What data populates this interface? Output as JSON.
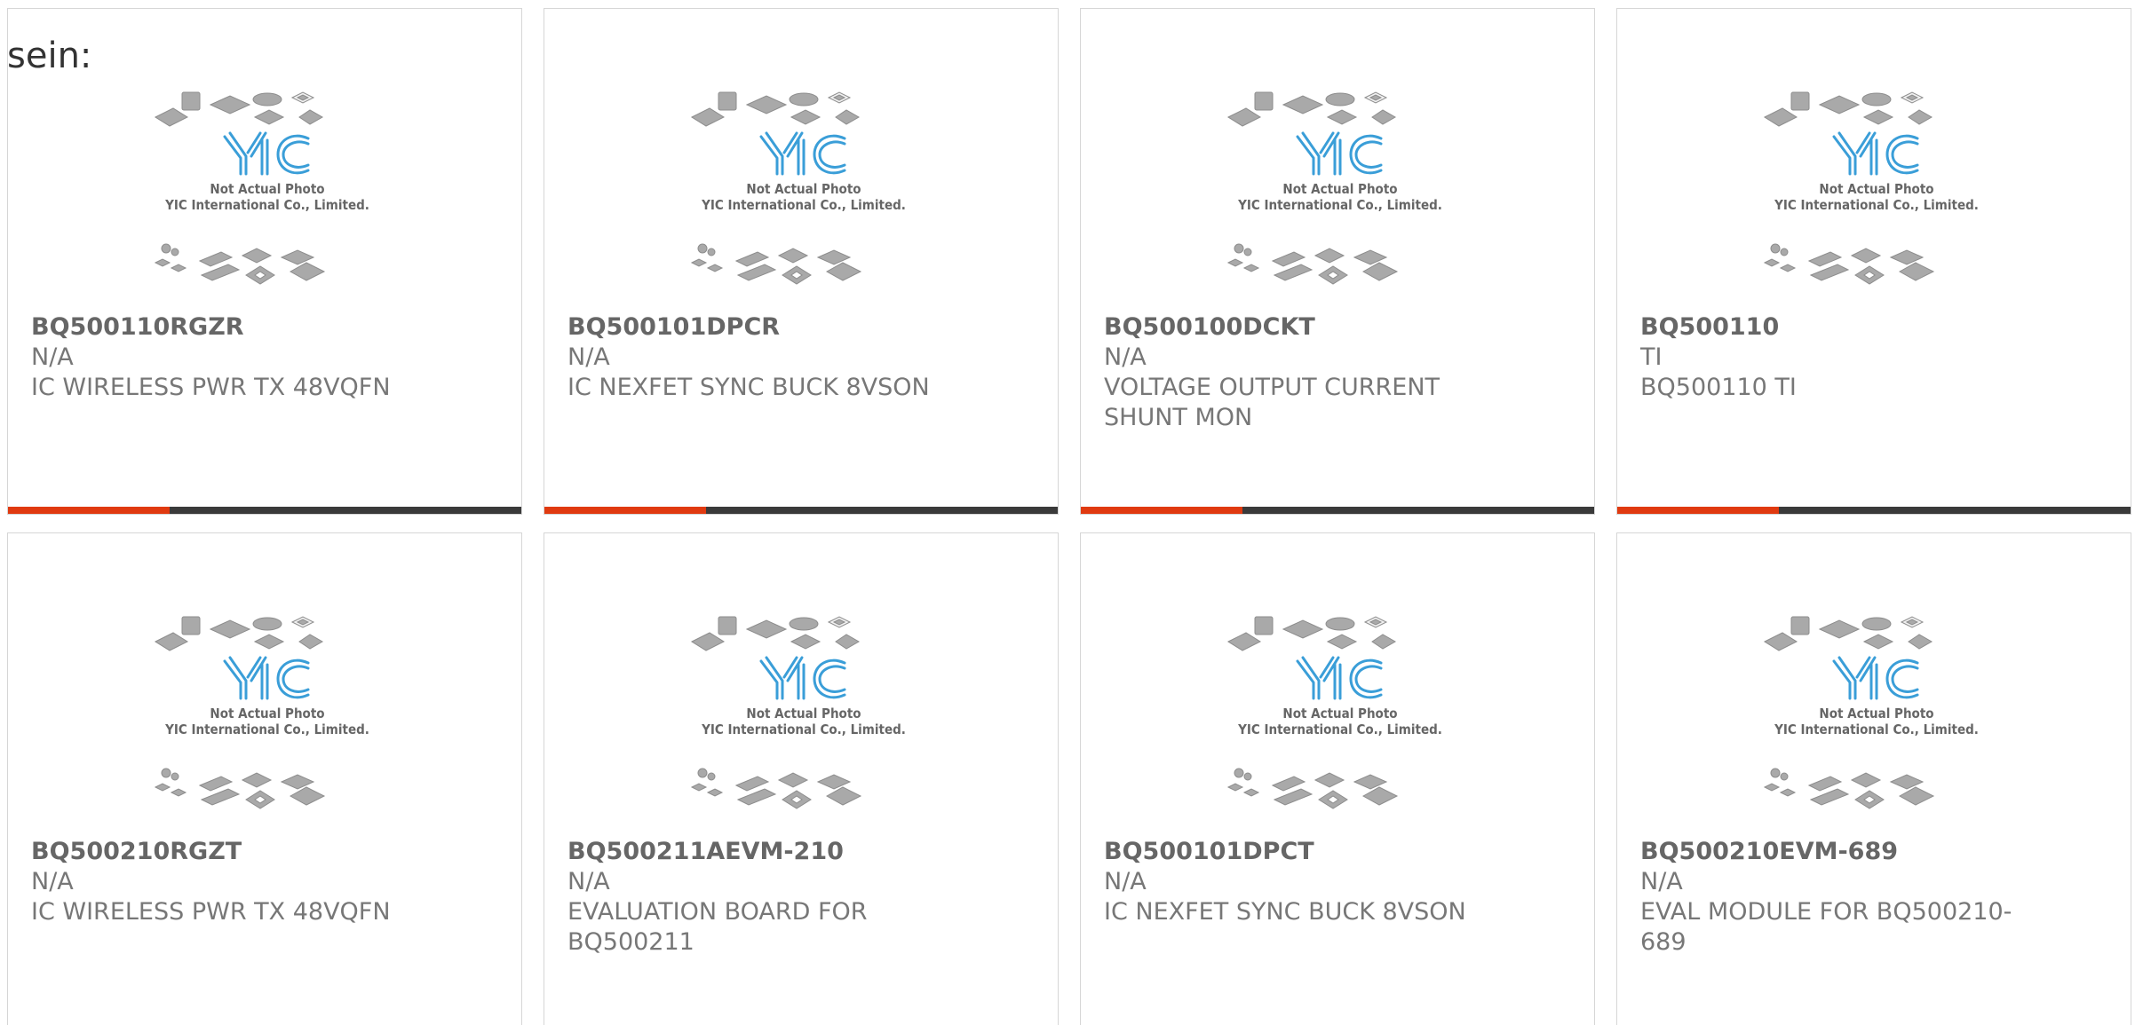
{
  "intro_text": "sein:",
  "image": {
    "brand": "YIC",
    "line1": "Not Actual Photo",
    "line2": "YIC International Co., Limited.",
    "brand_color": "#3a9ed8"
  },
  "colors": {
    "accent": "#e03a10",
    "bar": "#3a3a3a",
    "text": "#777777"
  },
  "products": [
    {
      "part_number": "BQ500110RGZR",
      "manufacturer": "N/A",
      "description": "IC WIRELESS PWR TX 48VQFN"
    },
    {
      "part_number": "BQ500101DPCR",
      "manufacturer": "N/A",
      "description": "IC NEXFET SYNC BUCK 8VSON"
    },
    {
      "part_number": "BQ500100DCKT",
      "manufacturer": "N/A",
      "description": "VOLTAGE OUTPUT CURRENT SHUNT MON"
    },
    {
      "part_number": "BQ500110",
      "manufacturer": "TI",
      "description": "BQ500110 TI"
    },
    {
      "part_number": "BQ500210RGZT",
      "manufacturer": "N/A",
      "description": "IC WIRELESS PWR TX 48VQFN"
    },
    {
      "part_number": "BQ500211AEVM-210",
      "manufacturer": "N/A",
      "description": "EVALUATION BOARD FOR BQ500211"
    },
    {
      "part_number": "BQ500101DPCT",
      "manufacturer": "N/A",
      "description": "IC NEXFET SYNC BUCK 8VSON"
    },
    {
      "part_number": "BQ500210EVM-689",
      "manufacturer": "N/A",
      "description": "EVAL MODULE FOR BQ500210-689"
    }
  ]
}
